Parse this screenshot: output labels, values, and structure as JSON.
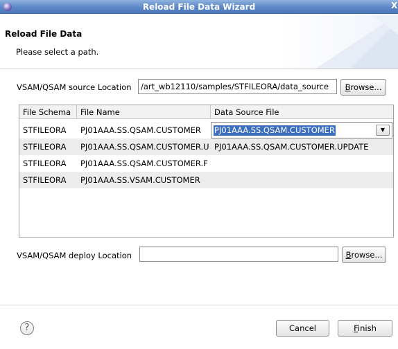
{
  "window": {
    "title": "Reload File Data Wizard",
    "close_label": "X"
  },
  "banner": {
    "heading": "Reload File Data",
    "description": "Please select a path."
  },
  "source": {
    "label": "VSAM/QSAM source Location",
    "value": "/art_wb12110/samples/STFILEORA/data_source",
    "browse_label": "Browse...",
    "browse_mnemonic": "B",
    "browse_rest": "rowse..."
  },
  "table": {
    "columns": [
      "File Schema",
      "File Name",
      "Data Source File"
    ],
    "rows": [
      {
        "schema": "STFILEORA",
        "file_name": "PJ01AAA.SS.QSAM.CUSTOMER",
        "data_source": "PJ01AAA.SS.QSAM.CUSTOMER"
      },
      {
        "schema": "STFILEORA",
        "file_name": "PJ01AAA.SS.QSAM.CUSTOMER.U",
        "data_source": "PJ01AAA.SS.QSAM.CUSTOMER.UPDATE"
      },
      {
        "schema": "STFILEORA",
        "file_name": "PJ01AAA.SS.QSAM.CUSTOMER.F",
        "data_source": ""
      },
      {
        "schema": "STFILEORA",
        "file_name": "PJ01AAA.SS.VSAM.CUSTOMER",
        "data_source": ""
      }
    ],
    "dropdown_arrow": "▼"
  },
  "deploy": {
    "label": "VSAM/QSAM deploy Location",
    "value": "",
    "browse_label": "Browse...",
    "browse_mnemonic": "B",
    "browse_rest": "rowse..."
  },
  "footer": {
    "help_glyph": "?",
    "cancel_label": "Cancel",
    "finish_label": "Finish",
    "finish_mnemonic": "F",
    "finish_rest": "inish"
  },
  "colors": {
    "title_bar": "#5d88c7",
    "selection": "#3d6fbf",
    "alt_row": "#ececec"
  }
}
